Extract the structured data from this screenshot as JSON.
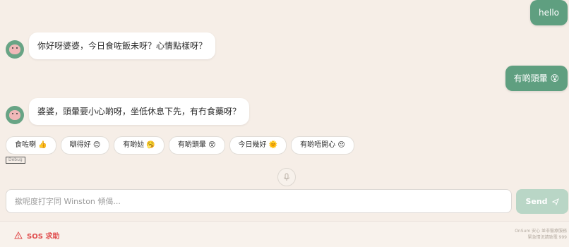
{
  "messages": [
    {
      "role": "user",
      "text": "hello"
    },
    {
      "role": "assistant",
      "text": "你好呀婆婆，今日食咗飯未呀？心情點樣呀？"
    },
    {
      "role": "user",
      "text": "有啲頭暈 😵"
    },
    {
      "role": "assistant",
      "text": "婆婆，頭暈要小心啲呀，坐低休息下先，有冇食藥呀？"
    }
  ],
  "quick_replies": [
    "食咗喇 👍",
    "瞓得好 😊",
    "有啲攰 🥱",
    "有啲頭暈 😵",
    "今日幾好 🌞",
    "有啲唔開心 😔"
  ],
  "debug_label": "Debug",
  "composer": {
    "placeholder": "撳呢度打字同 Winston 傾偈..."
  },
  "send_label": "Send",
  "footer": {
    "sos_label": "SOS 求助",
    "note_line1": "OnSum 安心 並非醫療服務",
    "note_line2": "緊急情況請致電 999"
  },
  "colors": {
    "accent": "#5f9f80",
    "danger": "#e04e4e",
    "background": "#f6eee7"
  }
}
